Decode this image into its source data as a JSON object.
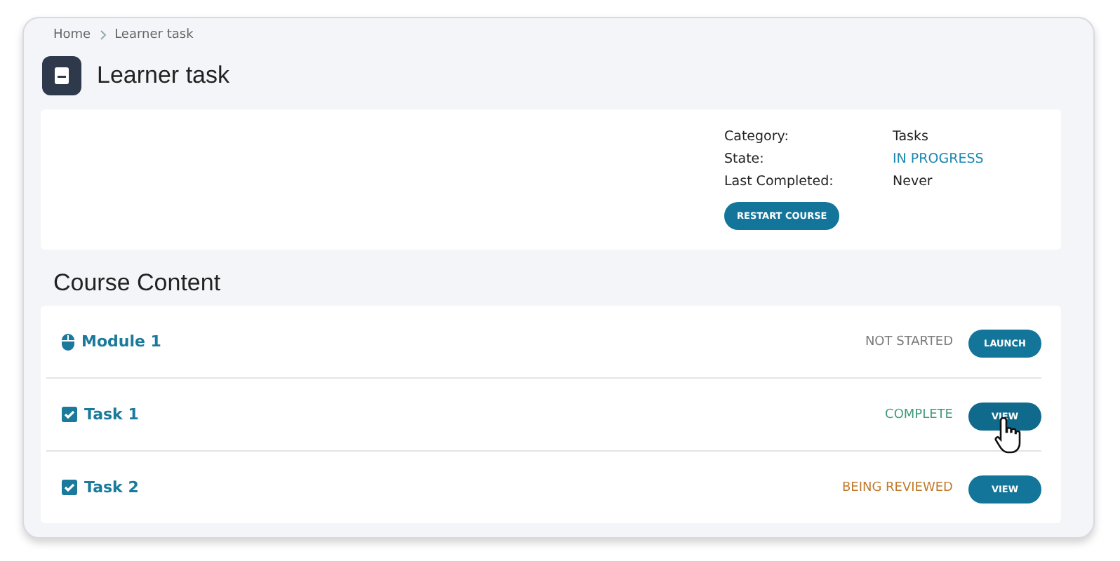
{
  "breadcrumb": [
    {
      "label": "Home"
    },
    {
      "label": "Learner task"
    }
  ],
  "title": "Learner task",
  "details": [
    {
      "label": "Category:",
      "value": "Tasks",
      "kind": "plain"
    },
    {
      "label": "State:",
      "value": "IN PROGRESS",
      "kind": "status"
    },
    {
      "label": "Last Completed:",
      "value": "Never",
      "kind": "plain"
    }
  ],
  "restart_button": "RESTART COURSE",
  "section_title": "Course Content",
  "items": [
    {
      "kind": "module",
      "name": "Module 1",
      "status": "NOT STARTED",
      "color": "#7a7a7a",
      "button": "LAUNCH",
      "hovered": false
    },
    {
      "kind": "task",
      "name": "Task 1",
      "status": "COMPLETE",
      "color": "#3e9a7c",
      "button": "VIEW",
      "hovered": true
    },
    {
      "kind": "task",
      "name": "Task 2",
      "status": "BEING REVIEWED",
      "color": "#c07a2c",
      "button": "VIEW",
      "hovered": false
    }
  ]
}
